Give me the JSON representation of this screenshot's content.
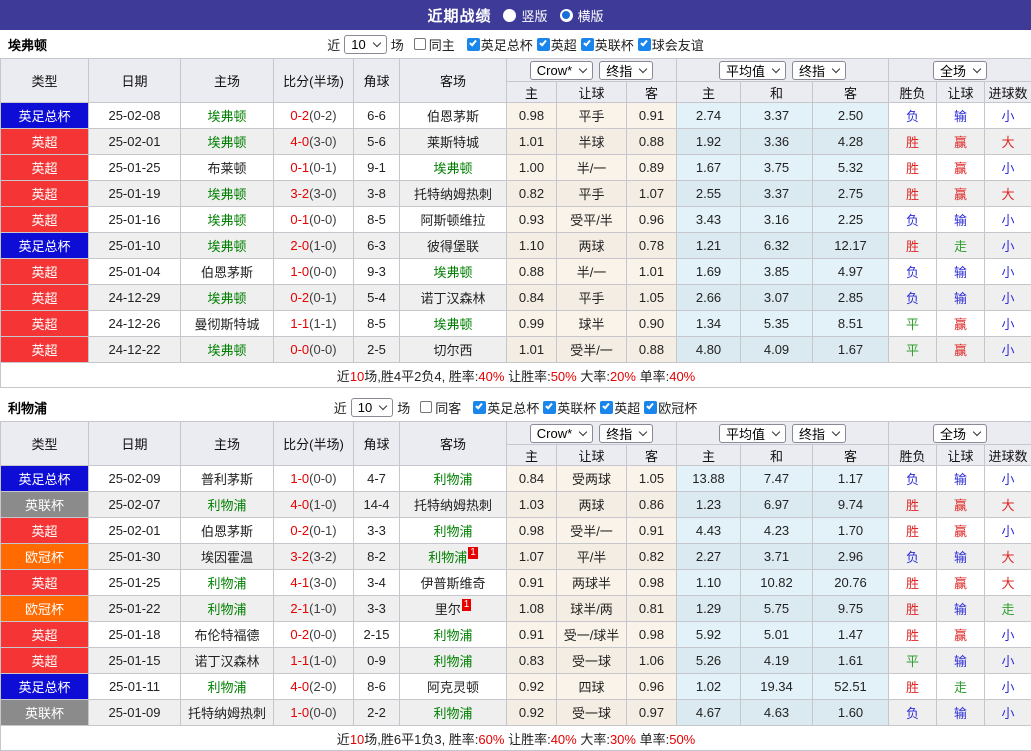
{
  "title": {
    "heading": "近期战绩",
    "radio_vertical": "竖版",
    "radio_horizontal": "横版"
  },
  "colors": {
    "titlebar": "#3e3b98",
    "leagues": {
      "英足总杯": "#0d0dd6",
      "英超": "#f53535",
      "英联杯": "#8b8b8b",
      "欧冠杯": "#ff6b00"
    },
    "results": {
      "r": "#e02525",
      "b": "#2d2dd8",
      "g": "#2f9e2f"
    },
    "score_red": "#e60000",
    "team_green": "#008000"
  },
  "columns": {
    "type": "类型",
    "date": "日期",
    "home": "主场",
    "score": "比分(半场)",
    "corner": "角球",
    "away": "客场",
    "odds_home": "主",
    "odds_handicap": "让球",
    "odds_away": "客",
    "avg_home": "主",
    "avg_draw": "和",
    "avg_away": "客",
    "result_wl": "胜负",
    "result_handicap": "让球",
    "result_goals": "进球数"
  },
  "dropdowns": {
    "odds_source": "Crow*",
    "odds_final": "终指",
    "avg_source": "平均值",
    "avg_final": "终指",
    "scope": "全场"
  },
  "filter_labels": {
    "prefix": "近",
    "suffix": "场"
  },
  "sections": [
    {
      "team": "埃弗顿",
      "filter": {
        "count": "10",
        "same_label": "同主",
        "leagues": [
          "英足总杯",
          "英超",
          "英联杯",
          "球会友谊"
        ]
      },
      "rows": [
        {
          "league": "英足总杯",
          "date": "25-02-08",
          "home": "埃弗顿",
          "hg": true,
          "hsup": "",
          "ft": "0-2",
          "ht": "(0-2)",
          "corner": "6-6",
          "away": "伯恩茅斯",
          "ag": false,
          "asup": "",
          "odds": [
            "0.98",
            "平手",
            "0.91"
          ],
          "avg": [
            "2.74",
            "3.37",
            "2.50"
          ],
          "res": [
            [
              "负",
              "b"
            ],
            [
              "输",
              "b"
            ],
            [
              "小",
              "b"
            ]
          ]
        },
        {
          "league": "英超",
          "date": "25-02-01",
          "home": "埃弗顿",
          "hg": true,
          "hsup": "",
          "ft": "4-0",
          "ht": "(3-0)",
          "corner": "5-6",
          "away": "莱斯特城",
          "ag": false,
          "asup": "",
          "odds": [
            "1.01",
            "半球",
            "0.88"
          ],
          "avg": [
            "1.92",
            "3.36",
            "4.28"
          ],
          "res": [
            [
              "胜",
              "r"
            ],
            [
              "赢",
              "r"
            ],
            [
              "大",
              "r"
            ]
          ]
        },
        {
          "league": "英超",
          "date": "25-01-25",
          "home": "布莱顿",
          "hg": false,
          "hsup": "",
          "ft": "0-1",
          "ht": "(0-1)",
          "corner": "9-1",
          "away": "埃弗顿",
          "ag": true,
          "asup": "",
          "odds": [
            "1.00",
            "半/一",
            "0.89"
          ],
          "avg": [
            "1.67",
            "3.75",
            "5.32"
          ],
          "res": [
            [
              "胜",
              "r"
            ],
            [
              "赢",
              "r"
            ],
            [
              "小",
              "b"
            ]
          ]
        },
        {
          "league": "英超",
          "date": "25-01-19",
          "home": "埃弗顿",
          "hg": true,
          "hsup": "",
          "ft": "3-2",
          "ht": "(3-0)",
          "corner": "3-8",
          "away": "托特纳姆热刺",
          "ag": false,
          "asup": "",
          "odds": [
            "0.82",
            "平手",
            "1.07"
          ],
          "avg": [
            "2.55",
            "3.37",
            "2.75"
          ],
          "res": [
            [
              "胜",
              "r"
            ],
            [
              "赢",
              "r"
            ],
            [
              "大",
              "r"
            ]
          ]
        },
        {
          "league": "英超",
          "date": "25-01-16",
          "home": "埃弗顿",
          "hg": true,
          "hsup": "",
          "ft": "0-1",
          "ht": "(0-0)",
          "corner": "8-5",
          "away": "阿斯顿维拉",
          "ag": false,
          "asup": "",
          "odds": [
            "0.93",
            "受平/半",
            "0.96"
          ],
          "avg": [
            "3.43",
            "3.16",
            "2.25"
          ],
          "res": [
            [
              "负",
              "b"
            ],
            [
              "输",
              "b"
            ],
            [
              "小",
              "b"
            ]
          ]
        },
        {
          "league": "英足总杯",
          "date": "25-01-10",
          "home": "埃弗顿",
          "hg": true,
          "hsup": "",
          "ft": "2-0",
          "ht": "(1-0)",
          "corner": "6-3",
          "away": "彼得堡联",
          "ag": false,
          "asup": "",
          "odds": [
            "1.10",
            "两球",
            "0.78"
          ],
          "avg": [
            "1.21",
            "6.32",
            "12.17"
          ],
          "res": [
            [
              "胜",
              "r"
            ],
            [
              "走",
              "g"
            ],
            [
              "小",
              "b"
            ]
          ]
        },
        {
          "league": "英超",
          "date": "25-01-04",
          "home": "伯恩茅斯",
          "hg": false,
          "hsup": "",
          "ft": "1-0",
          "ht": "(0-0)",
          "corner": "9-3",
          "away": "埃弗顿",
          "ag": true,
          "asup": "",
          "odds": [
            "0.88",
            "半/一",
            "1.01"
          ],
          "avg": [
            "1.69",
            "3.85",
            "4.97"
          ],
          "res": [
            [
              "负",
              "b"
            ],
            [
              "输",
              "b"
            ],
            [
              "小",
              "b"
            ]
          ]
        },
        {
          "league": "英超",
          "date": "24-12-29",
          "home": "埃弗顿",
          "hg": true,
          "hsup": "",
          "ft": "0-2",
          "ht": "(0-1)",
          "corner": "5-4",
          "away": "诺丁汉森林",
          "ag": false,
          "asup": "",
          "odds": [
            "0.84",
            "平手",
            "1.05"
          ],
          "avg": [
            "2.66",
            "3.07",
            "2.85"
          ],
          "res": [
            [
              "负",
              "b"
            ],
            [
              "输",
              "b"
            ],
            [
              "小",
              "b"
            ]
          ]
        },
        {
          "league": "英超",
          "date": "24-12-26",
          "home": "曼彻斯特城",
          "hg": false,
          "hsup": "",
          "ft": "1-1",
          "ht": "(1-1)",
          "corner": "8-5",
          "away": "埃弗顿",
          "ag": true,
          "asup": "",
          "odds": [
            "0.99",
            "球半",
            "0.90"
          ],
          "avg": [
            "1.34",
            "5.35",
            "8.51"
          ],
          "res": [
            [
              "平",
              "g"
            ],
            [
              "赢",
              "r"
            ],
            [
              "小",
              "b"
            ]
          ]
        },
        {
          "league": "英超",
          "date": "24-12-22",
          "home": "埃弗顿",
          "hg": true,
          "hsup": "",
          "ft": "0-0",
          "ht": "(0-0)",
          "corner": "2-5",
          "away": "切尔西",
          "ag": false,
          "asup": "",
          "odds": [
            "1.01",
            "受半/一",
            "0.88"
          ],
          "avg": [
            "4.80",
            "4.09",
            "1.67"
          ],
          "res": [
            [
              "平",
              "g"
            ],
            [
              "赢",
              "r"
            ],
            [
              "小",
              "b"
            ]
          ]
        }
      ],
      "summary": [
        [
          "近",
          0
        ],
        [
          "10",
          1
        ],
        [
          "场,胜4平2负4, 胜率:",
          0
        ],
        [
          "40%",
          1
        ],
        [
          " 让胜率:",
          0
        ],
        [
          "50%",
          1
        ],
        [
          " 大率:",
          0
        ],
        [
          "20%",
          1
        ],
        [
          " 单率:",
          0
        ],
        [
          "40%",
          1
        ]
      ]
    },
    {
      "team": "利物浦",
      "filter": {
        "count": "10",
        "same_label": "同客",
        "leagues": [
          "英足总杯",
          "英联杯",
          "英超",
          "欧冠杯"
        ]
      },
      "rows": [
        {
          "league": "英足总杯",
          "date": "25-02-09",
          "home": "普利茅斯",
          "hg": false,
          "hsup": "",
          "ft": "1-0",
          "ht": "(0-0)",
          "corner": "4-7",
          "away": "利物浦",
          "ag": true,
          "asup": "",
          "odds": [
            "0.84",
            "受两球",
            "1.05"
          ],
          "avg": [
            "13.88",
            "7.47",
            "1.17"
          ],
          "res": [
            [
              "负",
              "b"
            ],
            [
              "输",
              "b"
            ],
            [
              "小",
              "b"
            ]
          ]
        },
        {
          "league": "英联杯",
          "date": "25-02-07",
          "home": "利物浦",
          "hg": true,
          "hsup": "",
          "ft": "4-0",
          "ht": "(1-0)",
          "corner": "14-4",
          "away": "托特纳姆热刺",
          "ag": false,
          "asup": "",
          "odds": [
            "1.03",
            "两球",
            "0.86"
          ],
          "avg": [
            "1.23",
            "6.97",
            "9.74"
          ],
          "res": [
            [
              "胜",
              "r"
            ],
            [
              "赢",
              "r"
            ],
            [
              "大",
              "r"
            ]
          ]
        },
        {
          "league": "英超",
          "date": "25-02-01",
          "home": "伯恩茅斯",
          "hg": false,
          "hsup": "",
          "ft": "0-2",
          "ht": "(0-1)",
          "corner": "3-3",
          "away": "利物浦",
          "ag": true,
          "asup": "",
          "odds": [
            "0.98",
            "受半/一",
            "0.91"
          ],
          "avg": [
            "4.43",
            "4.23",
            "1.70"
          ],
          "res": [
            [
              "胜",
              "r"
            ],
            [
              "赢",
              "r"
            ],
            [
              "小",
              "b"
            ]
          ]
        },
        {
          "league": "欧冠杯",
          "date": "25-01-30",
          "home": "埃因霍温",
          "hg": false,
          "hsup": "",
          "ft": "3-2",
          "ht": "(3-2)",
          "corner": "8-2",
          "away": "利物浦",
          "ag": true,
          "asup": "1",
          "odds": [
            "1.07",
            "平/半",
            "0.82"
          ],
          "avg": [
            "2.27",
            "3.71",
            "2.96"
          ],
          "res": [
            [
              "负",
              "b"
            ],
            [
              "输",
              "b"
            ],
            [
              "大",
              "r"
            ]
          ]
        },
        {
          "league": "英超",
          "date": "25-01-25",
          "home": "利物浦",
          "hg": true,
          "hsup": "",
          "ft": "4-1",
          "ht": "(3-0)",
          "corner": "3-4",
          "away": "伊普斯维奇",
          "ag": false,
          "asup": "",
          "odds": [
            "0.91",
            "两球半",
            "0.98"
          ],
          "avg": [
            "1.10",
            "10.82",
            "20.76"
          ],
          "res": [
            [
              "胜",
              "r"
            ],
            [
              "赢",
              "r"
            ],
            [
              "大",
              "r"
            ]
          ]
        },
        {
          "league": "欧冠杯",
          "date": "25-01-22",
          "home": "利物浦",
          "hg": true,
          "hsup": "",
          "ft": "2-1",
          "ht": "(1-0)",
          "corner": "3-3",
          "away": "里尔",
          "ag": false,
          "asup": "1",
          "odds": [
            "1.08",
            "球半/两",
            "0.81"
          ],
          "avg": [
            "1.29",
            "5.75",
            "9.75"
          ],
          "res": [
            [
              "胜",
              "r"
            ],
            [
              "输",
              "b"
            ],
            [
              "走",
              "g"
            ]
          ]
        },
        {
          "league": "英超",
          "date": "25-01-18",
          "home": "布伦特福德",
          "hg": false,
          "hsup": "",
          "ft": "0-2",
          "ht": "(0-0)",
          "corner": "2-15",
          "away": "利物浦",
          "ag": true,
          "asup": "",
          "odds": [
            "0.91",
            "受一/球半",
            "0.98"
          ],
          "avg": [
            "5.92",
            "5.01",
            "1.47"
          ],
          "res": [
            [
              "胜",
              "r"
            ],
            [
              "赢",
              "r"
            ],
            [
              "小",
              "b"
            ]
          ]
        },
        {
          "league": "英超",
          "date": "25-01-15",
          "home": "诺丁汉森林",
          "hg": false,
          "hsup": "",
          "ft": "1-1",
          "ht": "(1-0)",
          "corner": "0-9",
          "away": "利物浦",
          "ag": true,
          "asup": "",
          "odds": [
            "0.83",
            "受一球",
            "1.06"
          ],
          "avg": [
            "5.26",
            "4.19",
            "1.61"
          ],
          "res": [
            [
              "平",
              "g"
            ],
            [
              "输",
              "b"
            ],
            [
              "小",
              "b"
            ]
          ]
        },
        {
          "league": "英足总杯",
          "date": "25-01-11",
          "home": "利物浦",
          "hg": true,
          "hsup": "",
          "ft": "4-0",
          "ht": "(2-0)",
          "corner": "8-6",
          "away": "阿克灵顿",
          "ag": false,
          "asup": "",
          "odds": [
            "0.92",
            "四球",
            "0.96"
          ],
          "avg": [
            "1.02",
            "19.34",
            "52.51"
          ],
          "res": [
            [
              "胜",
              "r"
            ],
            [
              "走",
              "g"
            ],
            [
              "小",
              "b"
            ]
          ]
        },
        {
          "league": "英联杯",
          "date": "25-01-09",
          "home": "托特纳姆热刺",
          "hg": false,
          "hsup": "",
          "ft": "1-0",
          "ht": "(0-0)",
          "corner": "2-2",
          "away": "利物浦",
          "ag": true,
          "asup": "",
          "odds": [
            "0.92",
            "受一球",
            "0.97"
          ],
          "avg": [
            "4.67",
            "4.63",
            "1.60"
          ],
          "res": [
            [
              "负",
              "b"
            ],
            [
              "输",
              "b"
            ],
            [
              "小",
              "b"
            ]
          ]
        }
      ],
      "summary": [
        [
          "近",
          0
        ],
        [
          "10",
          1
        ],
        [
          "场,胜6平1负3, 胜率:",
          0
        ],
        [
          "60%",
          1
        ],
        [
          " 让胜率:",
          0
        ],
        [
          "40%",
          1
        ],
        [
          " 大率:",
          0
        ],
        [
          "30%",
          1
        ],
        [
          " 单率:",
          0
        ],
        [
          "50%",
          1
        ]
      ]
    }
  ]
}
